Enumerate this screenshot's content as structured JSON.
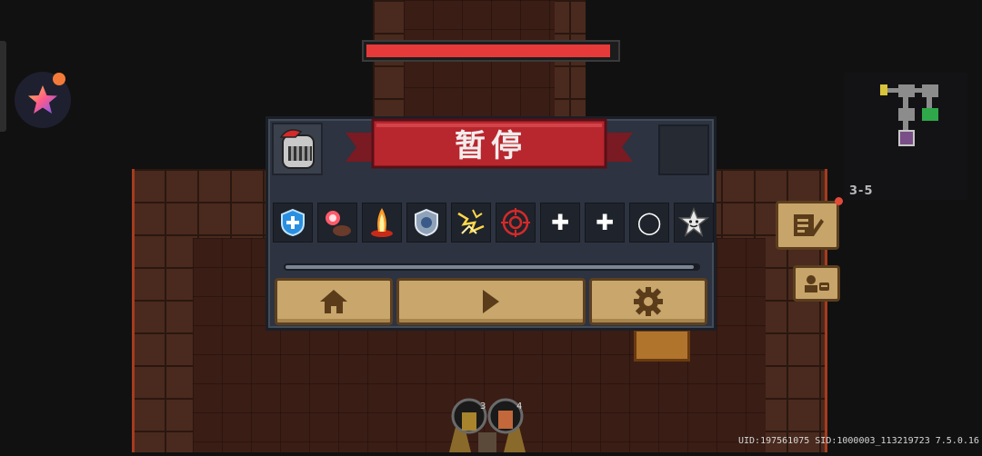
{
  "pause_menu": {
    "title": "暂停",
    "home_label": "home",
    "resume_label": "resume",
    "settings_label": "settings",
    "buffs": [
      {
        "icon": "blue-shield-buff-icon"
      },
      {
        "icon": "red-orb-buff-icon"
      },
      {
        "icon": "fire-pillar-buff-icon"
      },
      {
        "icon": "silver-shield-buff-icon"
      },
      {
        "icon": "lightning-buff-icon"
      },
      {
        "icon": "red-target-buff-icon"
      },
      {
        "icon": "plus-buff-icon",
        "glyph": "✚"
      },
      {
        "icon": "plus-buff-icon",
        "glyph": "✚"
      },
      {
        "icon": "ring-buff-icon",
        "glyph": "◯"
      },
      {
        "icon": "star-face-buff-icon"
      }
    ],
    "progress": 0.99
  },
  "boss_hp": 0.98,
  "minimap": {
    "level": "3-5"
  },
  "footer": {
    "uid_text": "UID:197561075 SID:1000003_113219723 7.5.0.16"
  },
  "hero": {
    "left_count": "3",
    "right_count": "4"
  },
  "colors": {
    "ribbon": "#b8262e",
    "button": "#c8a66c",
    "panel": "#2d3340",
    "hp": "#e63a3a"
  }
}
